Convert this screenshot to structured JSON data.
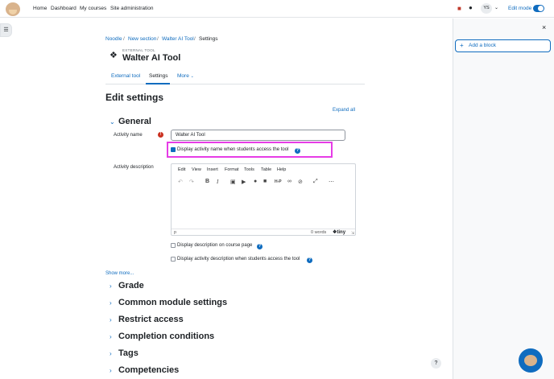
{
  "topnav": {
    "items": [
      "Home",
      "Dashboard",
      "My courses",
      "Site administration"
    ],
    "user_initials": "YS",
    "edit_mode_label": "Edit mode"
  },
  "breadcrumb": {
    "items": [
      "Noodle",
      "New section",
      "Walter AI Tool",
      "Settings"
    ],
    "separator": "/"
  },
  "header": {
    "subtitle": "EXTERNAL TOOL",
    "title": "Walter AI Tool"
  },
  "tabs": [
    "External tool",
    "Settings",
    "More"
  ],
  "page_title": "Edit settings",
  "expand_all": "Expand all",
  "general": {
    "heading": "General",
    "activity_name_label": "Activity name",
    "activity_name_value": "Walter AI Tool",
    "display_name_label": "Display activity name when students access the tool",
    "description_label": "Activity description",
    "editor_menu": [
      "Edit",
      "View",
      "Insert",
      "Format",
      "Tools",
      "Table",
      "Help"
    ],
    "editor_path": "p",
    "editor_words": "0 words",
    "editor_brand": "tiny",
    "display_desc_course_label": "Display description on course page",
    "display_desc_tool_label": "Display activity description when students access the tool",
    "show_more": "Show more..."
  },
  "sections": [
    "Grade",
    "Common module settings",
    "Restrict access",
    "Completion conditions",
    "Tags",
    "Competencies"
  ],
  "right_panel": {
    "add_block_label": "Add a block"
  },
  "colors": {
    "accent": "#0f6cbf",
    "highlight": "#e63ce6",
    "required": "#ca3120"
  }
}
